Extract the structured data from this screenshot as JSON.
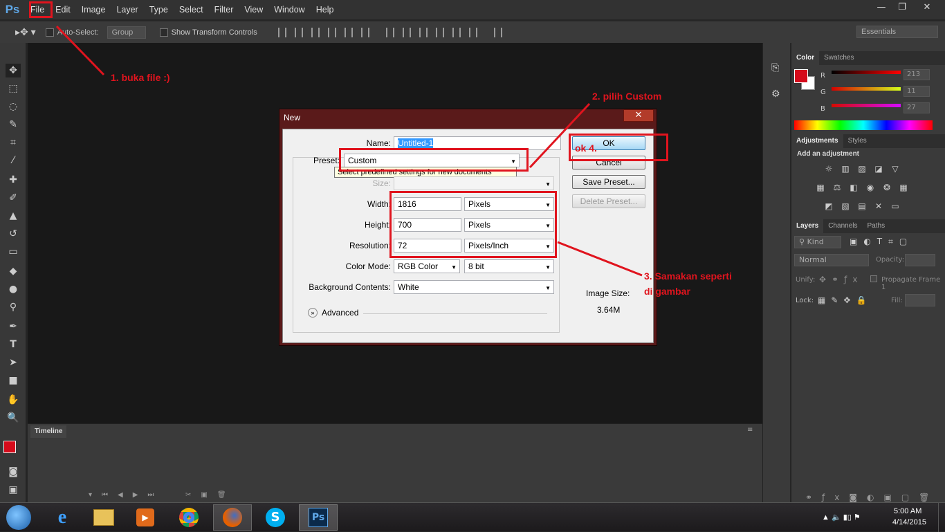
{
  "menubar": {
    "logo": "Ps",
    "items": [
      "File",
      "Edit",
      "Image",
      "Layer",
      "Type",
      "Select",
      "Filter",
      "View",
      "Window",
      "Help"
    ],
    "window_buttons": [
      "—",
      "❐",
      "✕"
    ]
  },
  "optionsbar": {
    "auto_select_label": "Auto-Select:",
    "auto_select_value": "Group",
    "show_transform_label": "Show Transform Controls",
    "workspace": "Essentials"
  },
  "panels": {
    "color_tabs": [
      "Color",
      "Swatches"
    ],
    "color": {
      "r_label": "R",
      "g_label": "G",
      "b_label": "B",
      "r": "213",
      "g": "11",
      "b": "27",
      "foreground": "#d50b1b"
    },
    "adjust_tabs": [
      "Adjustments",
      "Styles"
    ],
    "add_adjustment": "Add an adjustment",
    "layers_tabs": [
      "Layers",
      "Channels",
      "Paths"
    ],
    "kind": "Kind",
    "blend_mode": "Normal",
    "opacity_label": "Opacity:",
    "unify_label": "Unify:",
    "propagate_label": "Propagate Frame 1",
    "lock_label": "Lock:",
    "fill_label": "Fill:"
  },
  "timeline": {
    "tab": "Timeline"
  },
  "dialog": {
    "title": "New",
    "close": "✕",
    "name_label": "Name:",
    "name_value": "Untitled-1",
    "preset_label": "Preset:",
    "preset_value": "Custom",
    "tooltip": "Select predefined settings for new documents",
    "size_label": "Size:",
    "width_label": "Width:",
    "width_value": "1816",
    "width_unit": "Pixels",
    "height_label": "Height:",
    "height_value": "700",
    "height_unit": "Pixels",
    "resolution_label": "Resolution:",
    "resolution_value": "72",
    "resolution_unit": "Pixels/Inch",
    "color_mode_label": "Color Mode:",
    "color_mode_value": "RGB Color",
    "bit_depth": "8 bit",
    "bg_label": "Background Contents:",
    "bg_value": "White",
    "advanced_label": "Advanced",
    "ok": "OK",
    "cancel": "Cancel",
    "save_preset": "Save Preset...",
    "delete_preset": "Delete Preset...",
    "image_size_label": "Image Size:",
    "image_size_value": "3.64M"
  },
  "annotations": {
    "a1": "1. buka file :)",
    "a2": "2. pilih Custom",
    "a3_line1": "3. Samakan seperti",
    "a3_line2": "di gambar",
    "a4": "ok 4."
  },
  "taskbar": {
    "time": "5:00 AM",
    "date": "4/14/2015",
    "apps": [
      "start-orb",
      "internet-explorer",
      "file-explorer",
      "media-player",
      "chrome",
      "firefox",
      "skype",
      "photoshop"
    ]
  }
}
